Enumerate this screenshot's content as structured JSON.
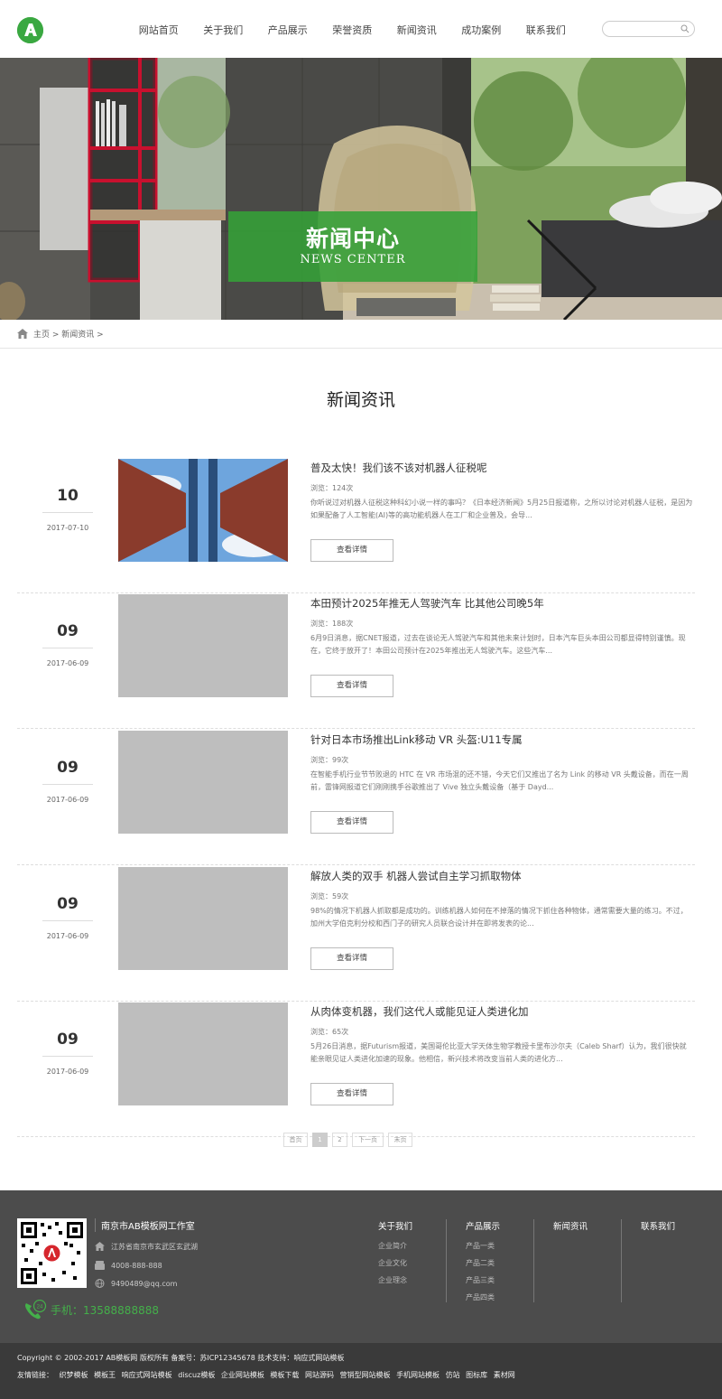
{
  "header": {
    "nav": [
      "网站首页",
      "关于我们",
      "产品展示",
      "荣誉资质",
      "新闻资讯",
      "成功案例",
      "联系我们"
    ],
    "search_placeholder": ""
  },
  "banner": {
    "title_cn": "新闻中心",
    "title_en": "NEWS CENTER"
  },
  "breadcrumb": {
    "home": "主页",
    "sep": " > ",
    "current": "新闻资讯",
    "trail": " >"
  },
  "section_title": "新闻资讯",
  "news": [
    {
      "day": "10",
      "date": "2017-07-10",
      "title": "普及太快！我们该不该对机器人征税呢",
      "views": "浏览：124次",
      "desc": "你听说过对机器人征税这种科幻小说一样的事吗？《日本经济新闻》5月25日报道称，之所以讨论对机器人征税，是因为如果配备了人工智能(AI)等的高功能机器人在工厂和企业普及，会导...",
      "button": "查看详情"
    },
    {
      "day": "09",
      "date": "2017-06-09",
      "title": "本田预计2025年推无人驾驶汽车 比其他公司晚5年",
      "views": "浏览：188次",
      "desc": "6月9日消息，据CNET报道，过去在谈论无人驾驶汽车和其他未来计划时，日本汽车巨头本田公司都显得特别谨慎。现在，它终于放开了！本田公司预计在2025年推出无人驾驶汽车。这些汽车...",
      "button": "查看详情"
    },
    {
      "day": "09",
      "date": "2017-06-09",
      "title": "针对日本市场推出Link移动 VR 头盔:U11专属",
      "views": "浏览：99次",
      "desc": "在智能手机行业节节败退的 HTC 在 VR 市场混的还不错，今天它们又推出了名为 Link 的移动 VR 头戴设备，而在一周前，雷锋网报道它们刚刚携手谷歌推出了 Vive 独立头戴设备（基于 Dayd...",
      "button": "查看详情"
    },
    {
      "day": "09",
      "date": "2017-06-09",
      "title": "解放人类的双手 机器人尝试自主学习抓取物体",
      "views": "浏览：59次",
      "desc": "98%的情况下机器人抓取都是成功的。训练机器人如何在不掉落的情况下抓住各种物体，通常需要大量的练习。不过，加州大学伯克利分校和西门子的研究人员联合设计并在即将发表的论...",
      "button": "查看详情"
    },
    {
      "day": "09",
      "date": "2017-06-09",
      "title": "从肉体变机器，我们这代人或能见证人类进化加",
      "views": "浏览：65次",
      "desc": "5月26日消息，据Futurism报道，美国哥伦比亚大学天体生物学教授卡里布沙尔夫（Caleb Sharf）认为，我们很快就能亲眼见证人类进化加速的现象。他相信，新兴技术将改变当前人类的进化方...",
      "button": "查看详情"
    }
  ],
  "pager": [
    "首页",
    "1",
    "2",
    "下一页",
    "末页"
  ],
  "footer": {
    "company": "南京市AB模板网工作室",
    "address": "江苏省南京市玄武区玄武湖",
    "phone": "4008-888-888",
    "email": "9490489@qq.com",
    "mobile": "手机：13588888888",
    "columns": [
      {
        "title": "关于我们",
        "items": [
          "企业简介",
          "企业文化",
          "企业理念"
        ]
      },
      {
        "title": "产品展示",
        "items": [
          "产品一类",
          "产品二类",
          "产品三类",
          "产品四类"
        ]
      },
      {
        "title": "新闻资讯",
        "items": []
      },
      {
        "title": "联系我们",
        "items": []
      }
    ],
    "copyright": "Copyright © 2002-2017 AB模板网 版权所有 备案号：苏ICP12345678 技术支持：响应式网站模板",
    "links_label": "友情链接：",
    "links": [
      "织梦模板",
      "模板王",
      "响应式网站模板",
      "discuz模板",
      "企业网站模板",
      "模板下载",
      "网站源码",
      "营销型网站模板",
      "手机网站模板",
      "仿站",
      "图标库",
      "素材网"
    ]
  },
  "colors": {
    "accent": "#3aa841",
    "footer_bg": "#4c4c4c",
    "bottom_bg": "#3a3a3a"
  }
}
